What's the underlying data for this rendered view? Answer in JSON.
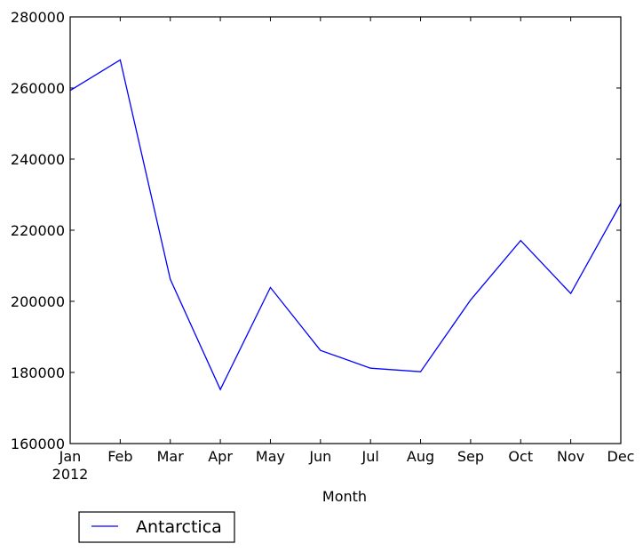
{
  "chart_data": {
    "type": "line",
    "title": "",
    "xlabel": "Month",
    "ylabel": "",
    "categories": [
      "Jan",
      "Feb",
      "Mar",
      "Apr",
      "May",
      "Jun",
      "Jul",
      "Aug",
      "Sep",
      "Oct",
      "Nov",
      "Dec"
    ],
    "x_sublabel": {
      "index": 0,
      "text": "2012"
    },
    "series": [
      {
        "name": "Antarctica",
        "color": "#0000ff",
        "values": [
          259300,
          267900,
          206200,
          175200,
          203900,
          186200,
          181200,
          180200,
          200400,
          217100,
          202200,
          227500
        ]
      }
    ],
    "ylim": [
      160000,
      280000
    ],
    "yticks": [
      160000,
      180000,
      200000,
      220000,
      240000,
      260000,
      280000
    ],
    "grid": false,
    "legend": {
      "placement": "bottom-left-outside",
      "entries": [
        "Antarctica"
      ]
    }
  }
}
